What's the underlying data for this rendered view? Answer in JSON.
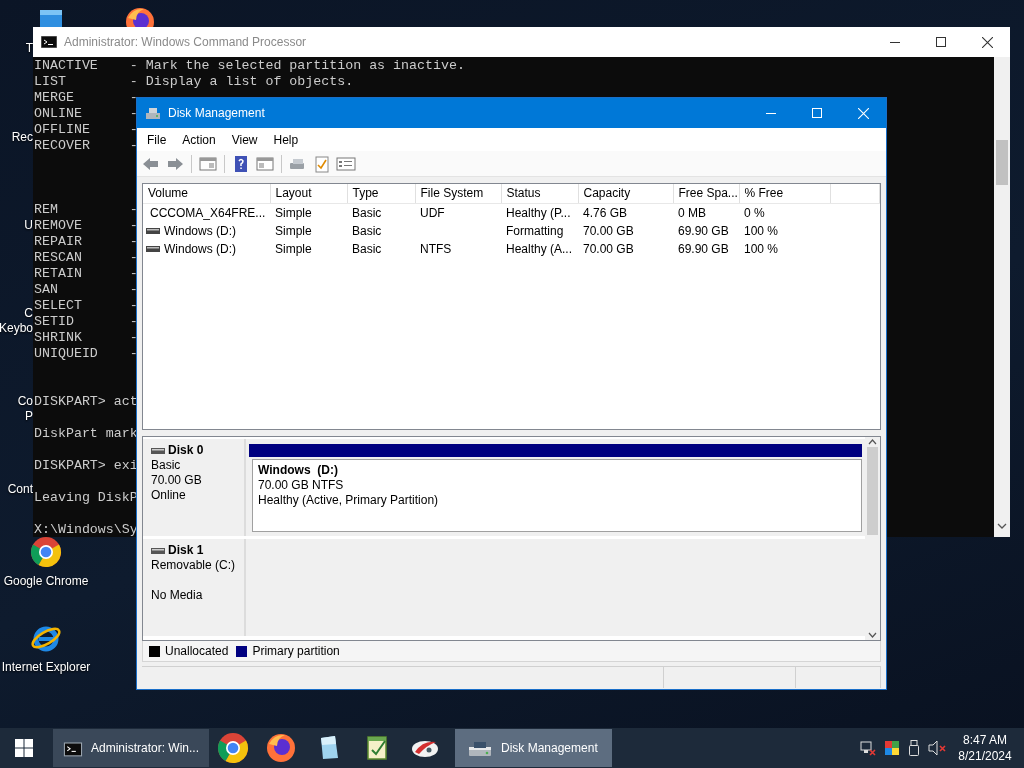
{
  "desktop": {
    "items": [
      {
        "kind": "label",
        "label": "T"
      },
      {
        "kind": "label",
        "label": "Rec"
      },
      {
        "kind": "label",
        "label": "U"
      },
      {
        "kind": "label",
        "label": "C"
      },
      {
        "kind": "label",
        "label": "Keybo"
      },
      {
        "kind": "label",
        "label": "Co"
      },
      {
        "kind": "label",
        "label": "P"
      },
      {
        "kind": "label",
        "label": "Cont"
      },
      {
        "kind": "chrome",
        "label": "Google Chrome"
      },
      {
        "kind": "ie",
        "label": "Internet Explorer"
      }
    ]
  },
  "cmd": {
    "title": "Administrator: Windows Command Processor",
    "active": false,
    "blocks": [
      [
        "INACTIVE    - Mark the selected partition as inactive.",
        "LIST        - Display a list of objects.",
        "MERGE       -",
        "ONLINE      -",
        "OFFLINE     -",
        "RECOVER     -"
      ],
      [
        "REM         -",
        "REMOVE      -",
        "REPAIR      -",
        "RESCAN      -",
        "RETAIN      -",
        "SAN         -",
        "SELECT      -",
        "SETID       -",
        "SHRINK      -",
        "UNIQUEID    -"
      ],
      [
        "DISKPART> act"
      ],
      [
        "DiskPart mark"
      ],
      [
        "DISKPART> exi"
      ],
      [
        "Leaving DiskP"
      ],
      [
        "X:\\Windows\\Sy"
      ]
    ]
  },
  "disk_management": {
    "title": "Disk Management",
    "active": true,
    "menu": [
      "File",
      "Action",
      "View",
      "Help"
    ],
    "columns": [
      "Volume",
      "Layout",
      "Type",
      "File System",
      "Status",
      "Capacity",
      "Free Spa...",
      "% Free"
    ],
    "volumes": [
      {
        "kind": "cd",
        "volume": "CCCOMA_X64FRE...",
        "layout": "Simple",
        "type": "Basic",
        "file_system": "UDF",
        "status": "Healthy (P...",
        "capacity": "4.76 GB",
        "free_space": "0 MB",
        "percent_free": "0 %"
      },
      {
        "kind": "drive",
        "volume": "Windows (D:)",
        "layout": "Simple",
        "type": "Basic",
        "status": "Formatting",
        "capacity": "70.00 GB",
        "free_space": "69.90 GB",
        "percent_free": "100 %"
      },
      {
        "kind": "drive",
        "volume": "Windows (D:)",
        "layout": "Simple",
        "type": "Basic",
        "file_system": "NTFS",
        "status": "Healthy (A...",
        "capacity": "70.00 GB",
        "free_space": "69.90 GB",
        "percent_free": "100 %"
      }
    ],
    "disks": [
      {
        "name": "Disk 0",
        "type": "Basic",
        "size": "70.00 GB",
        "status": "Online",
        "partitions": [
          {
            "name": "Windows  (D:)",
            "detail": "70.00 GB NTFS",
            "status": "Healthy (Active, Primary Partition)",
            "color": "#000080"
          }
        ]
      },
      {
        "name": "Disk 1",
        "type": "Removable (C:)",
        "status": "No Media"
      }
    ],
    "legend": [
      {
        "label": "Unallocated",
        "color": "#000000"
      },
      {
        "label": "Primary partition",
        "color": "#000080"
      }
    ]
  },
  "taskbar": {
    "items": [
      {
        "kind": "start"
      },
      {
        "kind": "window",
        "label": "Administrator: Win...",
        "selected": false
      },
      {
        "kind": "pinned"
      },
      {
        "kind": "pinned"
      },
      {
        "kind": "pinned"
      },
      {
        "kind": "pinned"
      },
      {
        "kind": "pinned"
      },
      {
        "kind": "window",
        "label": "Disk Management",
        "selected": true
      }
    ],
    "tray": {
      "time": "8:47 AM",
      "date": "8/21/2024"
    }
  }
}
